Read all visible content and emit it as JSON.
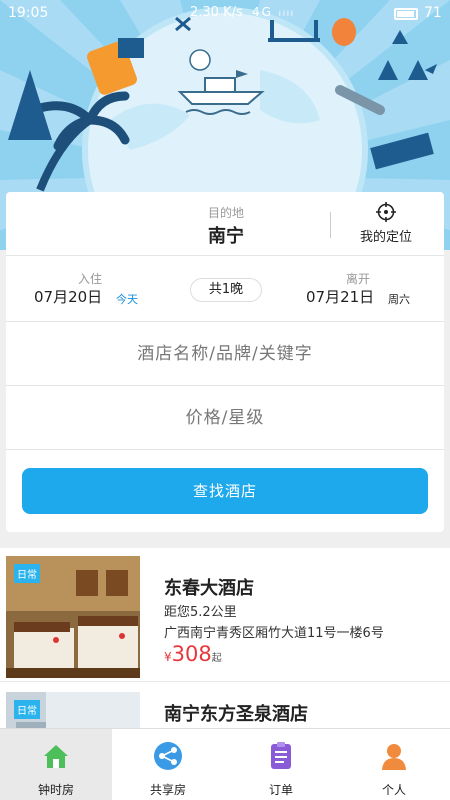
{
  "status_bar": {
    "time": "19:05",
    "speed": "2.30 K/s",
    "signal": "4G ᵢₗₗₗ",
    "battery": "71"
  },
  "search": {
    "destination_label": "目的地",
    "destination_value": "南宁",
    "locate_label": "我的定位",
    "checkin_label": "入住",
    "checkin_date": "07月20日",
    "checkin_tag": "今天",
    "nights": "共1晚",
    "checkout_label": "离开",
    "checkout_date": "07月21日",
    "checkout_tag": "周六",
    "keyword_placeholder": "酒店名称/品牌/关键字",
    "price_placeholder": "价格/星级",
    "button": "查找酒店"
  },
  "hotels": [
    {
      "tag": "日常",
      "name": "东春大酒店",
      "distance": "距您5.2公里",
      "address": "广西南宁青秀区厢竹大道11号一楼6号",
      "price_symbol": "¥",
      "price": "308",
      "price_unit": "起"
    },
    {
      "tag": "日常",
      "name": "南宁东方圣泉酒店"
    }
  ],
  "nav": [
    {
      "label": "钟时房",
      "icon": "home-icon"
    },
    {
      "label": "共享房",
      "icon": "share-icon"
    },
    {
      "label": "订单",
      "icon": "order-list-icon"
    },
    {
      "label": "个人",
      "icon": "person-icon"
    }
  ],
  "colors": {
    "accent": "#1ea9ec",
    "price": "#e8373c",
    "banner": "#8fd2f0",
    "nav_active": "#4cbf5a"
  }
}
